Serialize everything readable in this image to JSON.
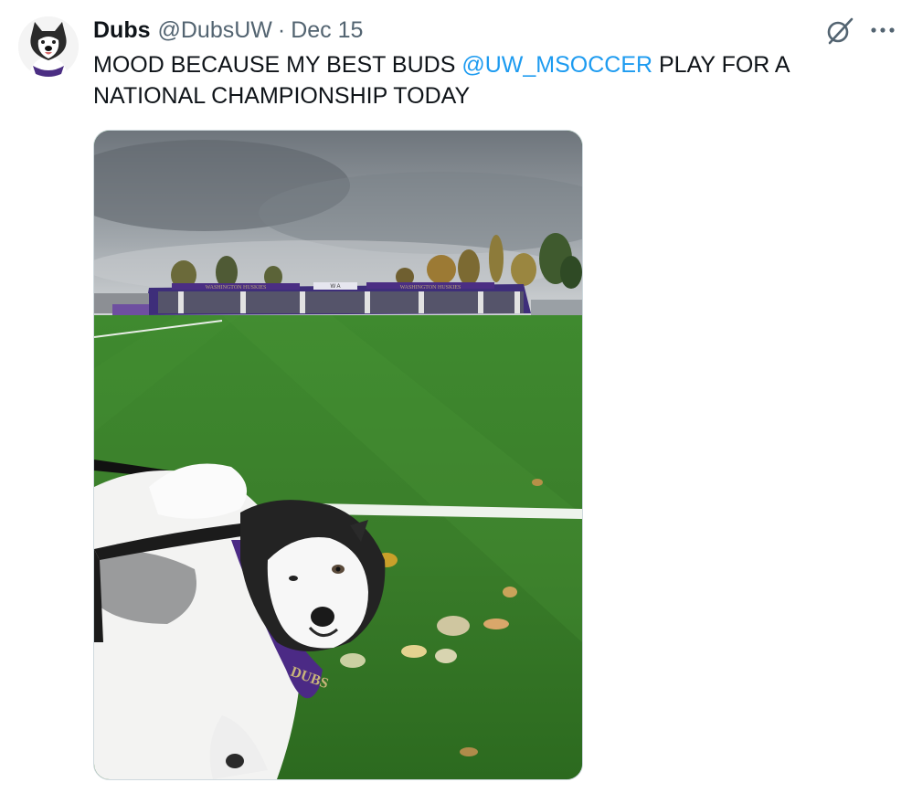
{
  "tweet": {
    "display_name": "Dubs",
    "handle": "@DubsUW",
    "separator": "·",
    "date": "Dec 15",
    "text_before": "MOOD BECAUSE MY BEST BUDS ",
    "mention": "@UW_MSOCCER",
    "text_after": " PLAY FOR A NATIONAL CHAMPIONSHIP TODAY"
  },
  "icons": {
    "avatar": "husky-avatar",
    "grok": "grok-icon",
    "more": "more-icon"
  },
  "media": {
    "stadium_signs": [
      "WASHINGTON HUSKIES",
      "W A",
      "WASHINGTON HUSKIES"
    ],
    "bandana_text": "DUBS"
  },
  "colors": {
    "mention": "#1d9bf0",
    "secondary_text": "#536471",
    "uw_purple": "#4b2e83",
    "uw_gold": "#b7a57a"
  }
}
